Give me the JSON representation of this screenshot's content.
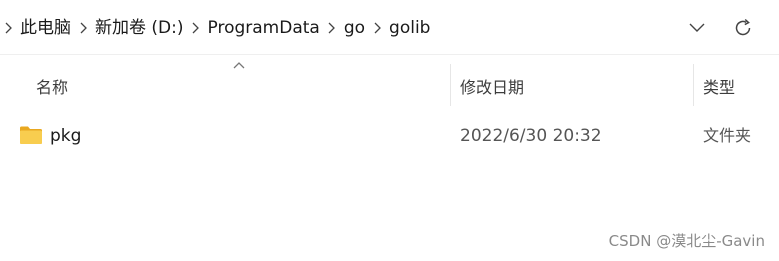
{
  "address_bar": {
    "breadcrumbs": [
      "此电脑",
      "新加卷 (D:)",
      "ProgramData",
      "go",
      "golib"
    ]
  },
  "columns": {
    "name": "名称",
    "date_modified": "修改日期",
    "type": "类型"
  },
  "files": [
    {
      "name": "pkg",
      "date_modified": "2022/6/30 20:32",
      "type": "文件夹",
      "icon": "folder-icon"
    }
  ],
  "watermark": "CSDN @漠北尘-Gavin",
  "colors": {
    "folder": "#f5c544",
    "folder_dark": "#e9a820",
    "text": "#1a1a1a",
    "muted": "#555555"
  }
}
